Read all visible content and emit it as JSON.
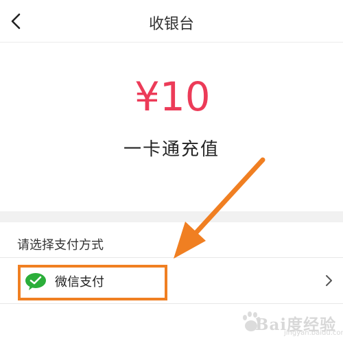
{
  "header": {
    "title": "收银台"
  },
  "order": {
    "amount": "¥10",
    "product": "一卡通充值"
  },
  "payment": {
    "section_label": "请选择支付方式",
    "methods": [
      {
        "label": "微信支付"
      }
    ]
  },
  "watermark": {
    "text": "Bai度经验",
    "sub": "jingyan.baidu.com"
  },
  "colors": {
    "amount": "#ec3b58",
    "highlight": "#f07f22",
    "wechat": "#2bae3a"
  }
}
